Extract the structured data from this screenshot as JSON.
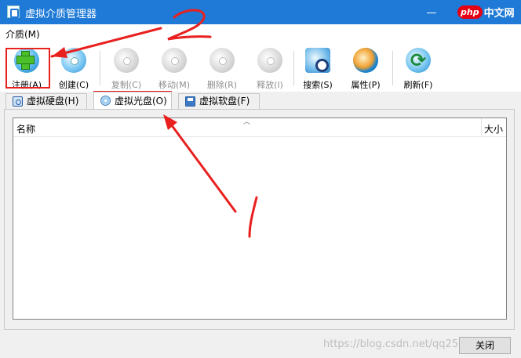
{
  "window": {
    "title": "虚拟介质管理器",
    "watermark_brand": "php",
    "watermark_text": "中文网"
  },
  "menu": {
    "items": [
      {
        "label": "介质(M)"
      }
    ]
  },
  "toolbar": {
    "buttons": [
      {
        "label": "注册(A)",
        "icon": "register-disk-icon",
        "enabled": true
      },
      {
        "label": "创建(C)",
        "icon": "create-disk-icon",
        "enabled": true
      },
      {
        "label": "复制(C)",
        "icon": "copy-disk-icon",
        "enabled": false
      },
      {
        "label": "移动(M)",
        "icon": "move-disk-icon",
        "enabled": false
      },
      {
        "label": "删除(R)",
        "icon": "delete-disk-icon",
        "enabled": false
      },
      {
        "label": "释放(l)",
        "icon": "release-disk-icon",
        "enabled": false
      },
      {
        "label": "搜索(S)",
        "icon": "search-icon",
        "enabled": true
      },
      {
        "label": "属性(P)",
        "icon": "properties-icon",
        "enabled": true
      },
      {
        "label": "刷新(F)",
        "icon": "refresh-icon",
        "enabled": true
      }
    ]
  },
  "tabs": [
    {
      "label": "虚拟硬盘(H)",
      "icon": "hard-disk-icon",
      "active": false
    },
    {
      "label": "虚拟光盘(O)",
      "icon": "optical-disk-icon",
      "active": true
    },
    {
      "label": "虚拟软盘(F)",
      "icon": "floppy-disk-icon",
      "active": false
    }
  ],
  "list": {
    "columns": [
      "名称",
      "大小"
    ],
    "rows": []
  },
  "footer": {
    "close_label": "关闭",
    "watermark": "https://blog.csdn.net/qq252..."
  },
  "annotations": {
    "arrow1_label": "1",
    "arrow2_label": "2",
    "color": "#e8201e"
  }
}
